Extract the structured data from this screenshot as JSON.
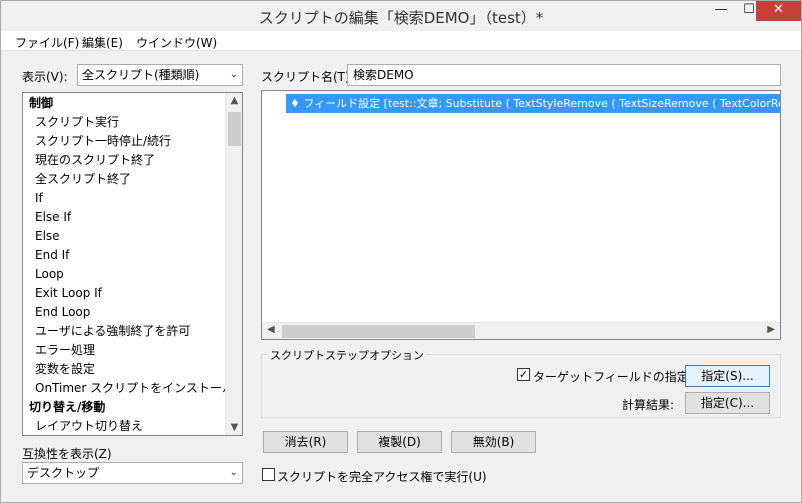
{
  "window": {
    "title": "スクリプトの編集「検索DEMO」（test）*",
    "minimize_glyph": "—",
    "maximize_glyph": "☐",
    "close_glyph": "✕"
  },
  "menubar": {
    "file": "ファイル(F)",
    "edit": "編集(E)",
    "window": "ウインドウ(W)"
  },
  "left_panel": {
    "show_label": "表示(V):",
    "show_value": "全スクリプト(種類順)",
    "steps": [
      {
        "label": "制御",
        "category": true
      },
      {
        "label": "スクリプト実行",
        "category": false
      },
      {
        "label": "スクリプト一時停止/続行",
        "category": false
      },
      {
        "label": "現在のスクリプト終了",
        "category": false
      },
      {
        "label": "全スクリプト終了",
        "category": false
      },
      {
        "label": "If",
        "category": false
      },
      {
        "label": "Else If",
        "category": false
      },
      {
        "label": "Else",
        "category": false
      },
      {
        "label": "End If",
        "category": false
      },
      {
        "label": "Loop",
        "category": false
      },
      {
        "label": "Exit Loop If",
        "category": false
      },
      {
        "label": "End Loop",
        "category": false
      },
      {
        "label": "ユーザによる強制終了を許可",
        "category": false
      },
      {
        "label": "エラー処理",
        "category": false
      },
      {
        "label": "変数を設定",
        "category": false
      },
      {
        "label": "OnTimer スクリプトをインストール",
        "category": false
      },
      {
        "label": "切り替え/移動",
        "category": true
      },
      {
        "label": "レイアウト切り替え",
        "category": false
      }
    ],
    "compat_label": "互換性を表示(Z)",
    "compat_value": "デスクトップ"
  },
  "right_panel": {
    "script_name_label": "スクリプト名(T):",
    "script_name_value": "検索DEMO",
    "script_step": "♦  フィールド設定 [test::文章; Substitute ( TextStyleRemove (  TextSizeRemove (  TextColorRemove",
    "options_title": "スクリプトステップオプション",
    "target_field_label": "ターゲットフィールドの指定(Y)",
    "target_field_checked": true,
    "specify_button_1": "指定(S)...",
    "calc_result_label": "計算結果:",
    "specify_button_2": "指定(C)...",
    "clear_button": "消去(R)",
    "duplicate_button": "複製(D)",
    "disable_button": "無効(B)",
    "full_access_label": "スクリプトを完全アクセス権で実行(U)",
    "full_access_checked": false
  }
}
